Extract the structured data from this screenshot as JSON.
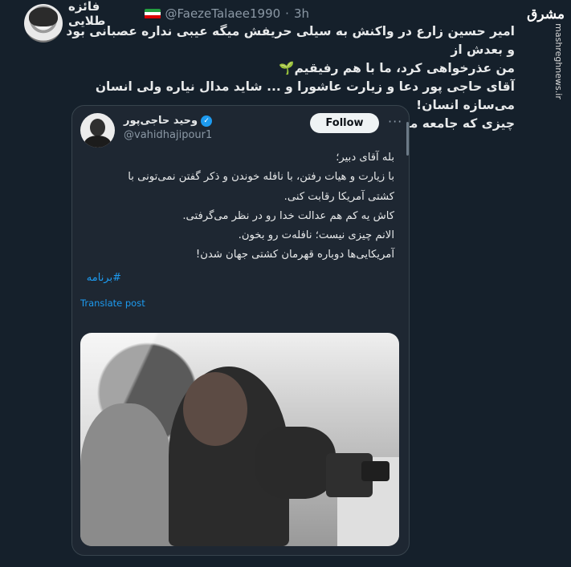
{
  "tweet": {
    "author_name": "فائزه طلایی",
    "handle": "@FaezeTalaee1990",
    "dot": "·",
    "time": "3h",
    "lines": [
      "امیر حسین زارع در واکنش به سیلی حریفش میگه عیبی نداره عصبانی بود و بعدش از",
      "من عذرخواهی کرد، ما با هم رفیقیم",
      "آقای حاجی پور دعا و زیارت عاشورا و ... شاید مدال نیاره ولی انسان می‌سازه انسان!",
      "چیزی که جامعه ما و همه جوامع خیلی بیشتر از مدال بهش نیاز داره!"
    ],
    "sprout": "🌱",
    "flag_colors": [
      "#239f40",
      "#ffffff",
      "#da0000"
    ]
  },
  "watermark": {
    "logo": "مشرق",
    "site": "mashreghnews.ir"
  },
  "quoted": {
    "author_name": "وحید حاجی‌پور",
    "verified_icon": "✓",
    "handle": "@vahidhajipour1",
    "follow_label": "Follow",
    "more_icon": "···",
    "lines": [
      "بله آقای دبیر؛",
      "با زیارت و هیات رفتن، با نافله خوندن و ذکر گفتن نمی‌تونی با",
      "کشتی آمریکا رقابت کنی.",
      "کاش یه کم هم عدالت خدا رو در نظر می‌گرفتی.",
      "الانم چیزی نیست؛ نافله‌ت رو بخون.",
      "آمریکایی‌ها دوباره قهرمان کشتی جهان شدن!"
    ],
    "hashtag": "#برنامه",
    "translate_label": "Translate post"
  },
  "colors": {
    "background": "#15202b",
    "card_background": "#1e2732",
    "text": "#e7e9ea",
    "secondary": "#8b98a5",
    "accent": "#1d9bf0"
  }
}
